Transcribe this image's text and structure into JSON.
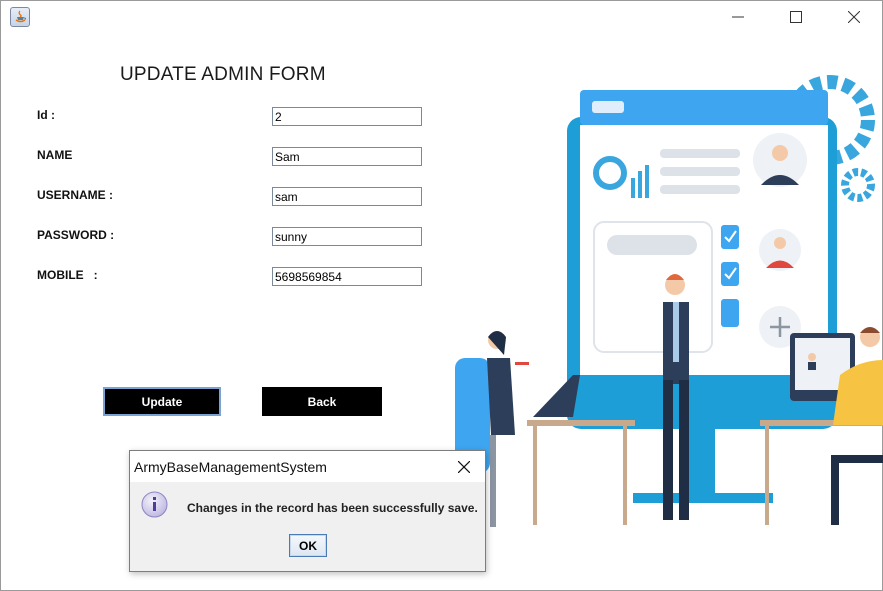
{
  "window": {
    "title": "",
    "min_icon": "minimize-icon",
    "max_icon": "maximize-icon",
    "close_icon": "close-icon"
  },
  "form": {
    "title": "UPDATE ADMIN FORM",
    "fields": [
      {
        "label": "Id :",
        "value": "2"
      },
      {
        "label": "NAME",
        "value": "Sam"
      },
      {
        "label": "USERNAME :",
        "value": "sam"
      },
      {
        "label": "PASSWORD :",
        "value": "sunny"
      },
      {
        "label": "MOBILE   :",
        "value": "5698569854"
      }
    ],
    "update_label": "Update",
    "back_label": "Back"
  },
  "dialog": {
    "title": "ArmyBaseManagementSystem",
    "message": "Changes in the record has been successfully save.",
    "ok_label": "OK",
    "icon": "info-icon"
  },
  "colors": {
    "button_bg": "#000000",
    "accent_blue": "#2fa3d8",
    "dialog_bg": "#f0f0f0"
  }
}
